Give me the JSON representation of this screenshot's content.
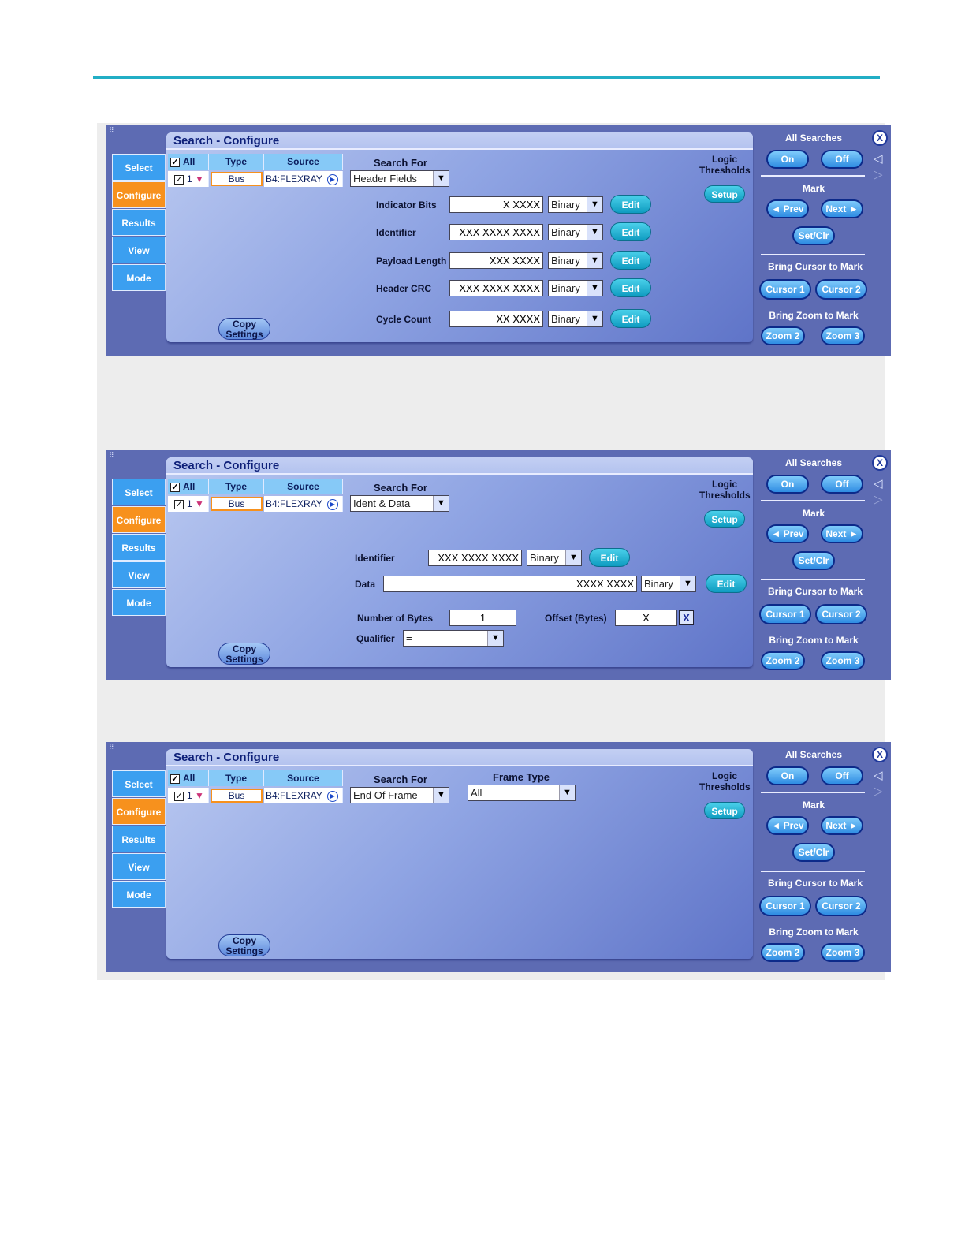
{
  "colors": {
    "accent_line": "#22aec5",
    "active_tab": "#f7911d",
    "tab": "#3b9ff0",
    "panel": "#5d6bb3"
  },
  "common": {
    "title": "Search - Configure",
    "tabs": [
      "Select",
      "Configure",
      "Results",
      "View",
      "Mode"
    ],
    "grid_headers": {
      "all": "All",
      "type": "Type",
      "source": "Source"
    },
    "grid_row": {
      "num": "1",
      "type": "Bus",
      "source": "B4:FLEXRAY"
    },
    "search_for_label": "Search For",
    "logic_thresholds": "Logic Thresholds",
    "setup": "Setup",
    "copy_settings": "Copy Settings",
    "all_searches": "All Searches",
    "on": "On",
    "off": "Off",
    "mark": "Mark",
    "prev": "◄ Prev",
    "next": "Next ►",
    "set_clr": "Set/Clr",
    "bring_cursor": "Bring Cursor to Mark",
    "cursor1": "Cursor 1",
    "cursor2": "Cursor 2",
    "bring_zoom": "Bring Zoom to Mark",
    "zoom2": "Zoom 2",
    "zoom3": "Zoom 3",
    "close": "X",
    "edit": "Edit",
    "binary": "Binary"
  },
  "panel1": {
    "search_for": "Header Fields",
    "rows": [
      {
        "label": "Indicator Bits",
        "value": "X XXXX"
      },
      {
        "label": "Identifier",
        "value": "XXX XXXX XXXX"
      },
      {
        "label": "Payload Length",
        "value": "XXX XXXX"
      },
      {
        "label": "Header CRC",
        "value": "XXX XXXX XXXX"
      },
      {
        "label": "Cycle Count",
        "value": "XX XXXX"
      }
    ]
  },
  "panel2": {
    "search_for": "Ident & Data",
    "identifier_label": "Identifier",
    "identifier_value": "XXX XXXX XXXX",
    "data_label": "Data",
    "data_value": "XXXX XXXX",
    "num_bytes_label": "Number of Bytes",
    "num_bytes_value": "1",
    "offset_label": "Offset (Bytes)",
    "offset_value": "X",
    "qualifier_label": "Qualifier",
    "qualifier_value": "="
  },
  "panel3": {
    "search_for": "End Of Frame",
    "frame_type_label": "Frame Type",
    "frame_type_value": "All"
  }
}
